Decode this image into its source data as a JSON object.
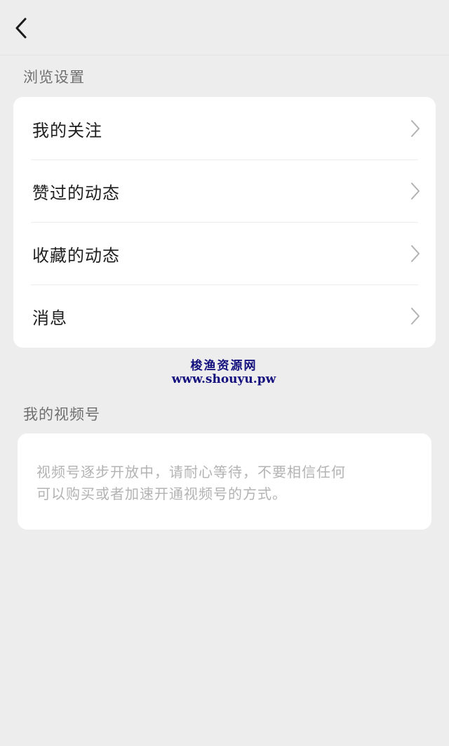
{
  "browse_section": {
    "title": "浏览设置",
    "items": [
      {
        "label": "我的关注"
      },
      {
        "label": "赞过的动态"
      },
      {
        "label": "收藏的动态"
      },
      {
        "label": "消息"
      }
    ]
  },
  "watermark": {
    "title": "梭渔资源网",
    "url": "www.shouyu.pw"
  },
  "channel_section": {
    "title": "我的视频号",
    "notice_line1": "视频号逐步开放中，请耐心等待，不要相信任何",
    "notice_line2": "可以购买或者加速开通视频号的方式。"
  },
  "icons": {
    "back": "chevron-left-icon",
    "row_arrow": "chevron-right-icon"
  },
  "colors": {
    "background": "#ededed",
    "card": "#ffffff",
    "watermark": "#13107e"
  }
}
